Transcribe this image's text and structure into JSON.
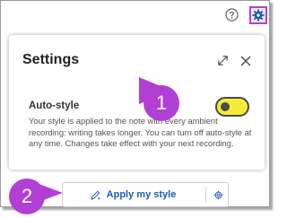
{
  "header": {
    "help_icon": "question-circle-icon",
    "settings_icon": "gear-icon"
  },
  "settings_panel": {
    "title": "Settings",
    "expand_icon": "expand-icon",
    "close_icon": "close-icon",
    "auto_style": {
      "label": "Auto-style",
      "description": "Your style is applied to the note with every ambient recording: writing takes longer. You can turn off auto-style at any time. Changes take effect with your next recording.",
      "toggle_state": "off"
    }
  },
  "apply_bar": {
    "button_label": "Apply my style",
    "button_icon": "pen-sparkle-icon",
    "settings_icon": "gear-icon"
  },
  "callouts": {
    "one": "1",
    "two": "2"
  },
  "colors": {
    "callout": "#b23fd3",
    "toggle_fill": "#f4ec3a",
    "accent": "#1b5bb7"
  }
}
